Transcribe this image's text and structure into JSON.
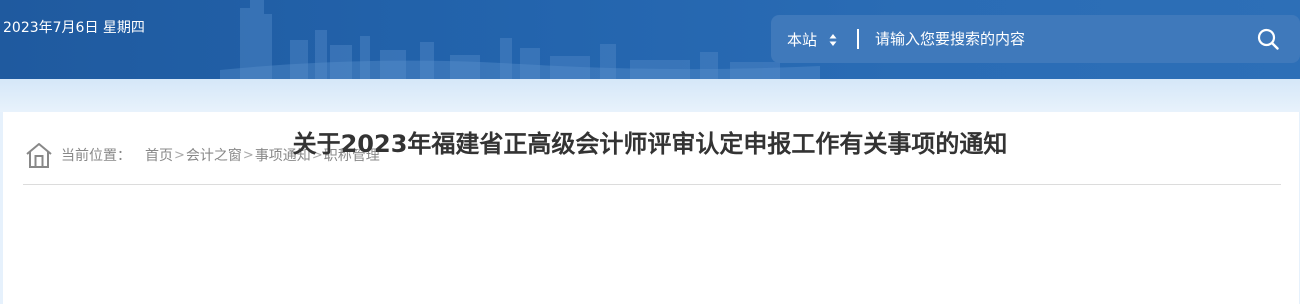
{
  "header": {
    "date": "2023年7月6日 星期四",
    "colors": {
      "banner": "#2364ad",
      "search_bg": "#3f79bb"
    }
  },
  "search": {
    "scope_label": "本站",
    "placeholder": "请输入您要搜索的内容",
    "scope_icon": "up-down-arrows-icon",
    "button_icon": "search-icon"
  },
  "breadcrumb": {
    "icon": "home-icon",
    "prefix": "当前位置：",
    "items": [
      "首页",
      "会计之窗",
      "事项通知",
      "职称管理"
    ],
    "separator": ">"
  },
  "article": {
    "title": "关于2023年福建省正高级会计师评审认定申报工作有关事项的通知"
  }
}
